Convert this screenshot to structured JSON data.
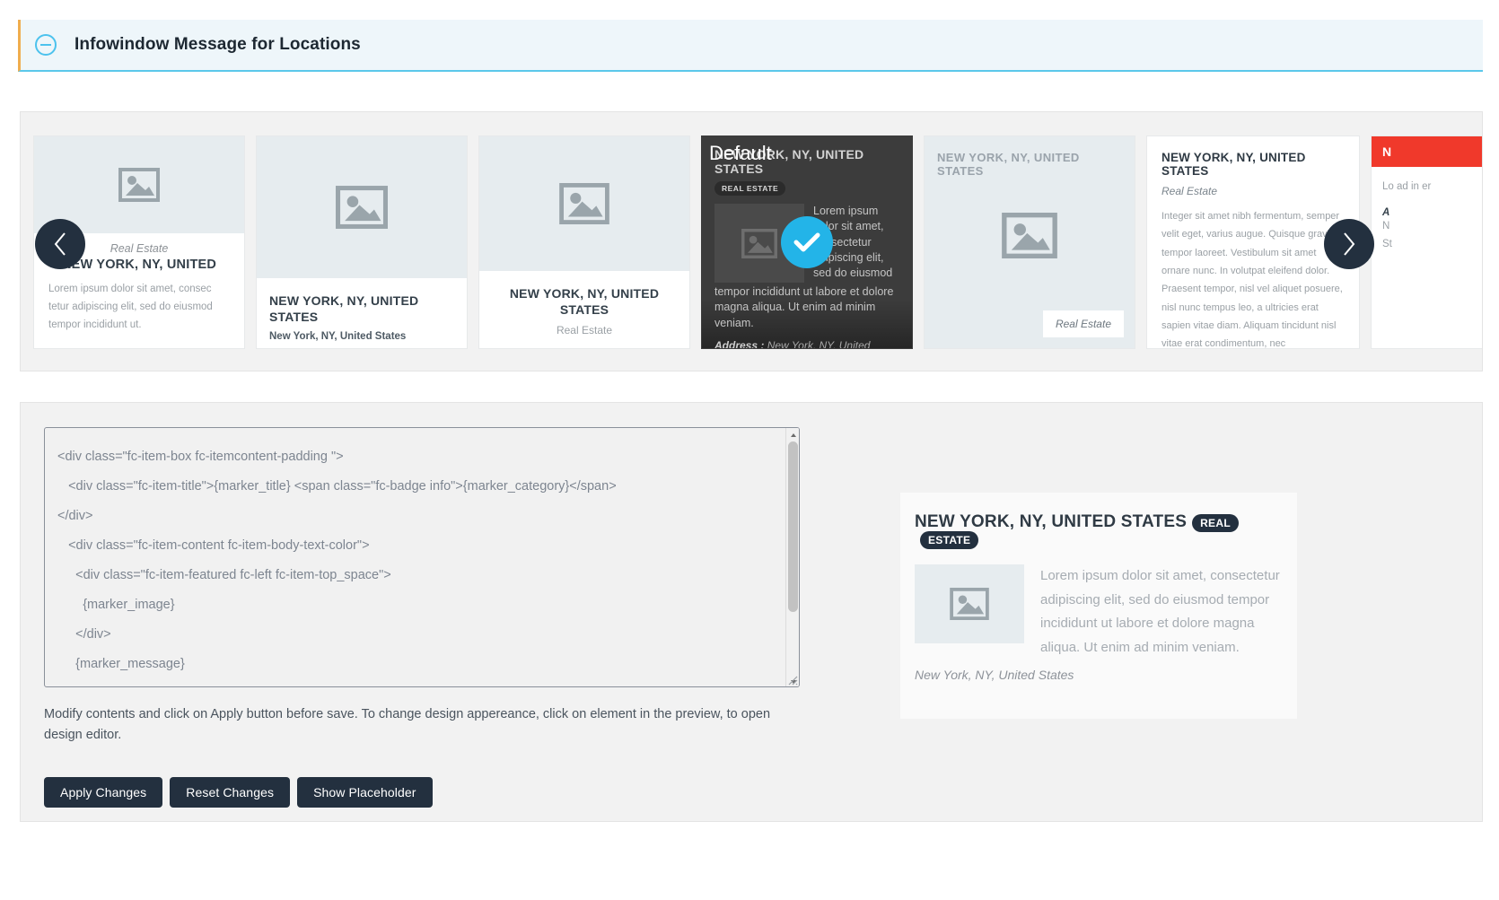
{
  "panel": {
    "title": "Infowindow Message for Locations",
    "collapse_icon": "minus-circle-icon"
  },
  "carousel": {
    "prev_label": "‹",
    "next_label": "›",
    "selected_label": "Default",
    "templates": [
      {
        "id": "template-1",
        "category": "Real Estate",
        "title": "NEW YORK, NY, UNITED",
        "body": "Lorem ipsum dolor sit amet, consec tetur adipiscing elit, sed do eiusmod tempor incididunt ut.",
        "image_icon": "image-placeholder-icon"
      },
      {
        "id": "template-2",
        "title": "NEW YORK, NY, UNITED STATES",
        "subtitle": "New York, NY, United States",
        "image_icon": "image-placeholder-icon"
      },
      {
        "id": "template-3",
        "title": "NEW YORK, NY, UNITED STATES",
        "category": "Real Estate",
        "image_icon": "image-placeholder-icon"
      },
      {
        "id": "template-4-default",
        "title": "NEW YORK, NY, UNITED STATES",
        "badge": "REAL ESTATE",
        "body_col": "Lorem ipsum dolor sit amet, consectetur adipiscing elit, sed do eiusmod",
        "body_flow": "tempor incididunt ut labore et dolore magna aliqua. Ut enim ad minim veniam.",
        "address_label": "Address :",
        "address_value": " New York, NY, United States",
        "image_icon": "image-placeholder-icon",
        "selected": true
      },
      {
        "id": "template-5",
        "title": "NEW YORK, NY, UNITED STATES",
        "category": "Real Estate",
        "image_icon": "image-placeholder-icon"
      },
      {
        "id": "template-6",
        "title": "NEW YORK, NY, UNITED STATES",
        "category": "Real Estate",
        "body": "Integer sit amet nibh fermentum, semper velit eget, varius augue. Quisque gravida tempor laoreet. Vestibulum sit amet ornare nunc. In volutpat eleifend dolor. Praesent tempor, nisl vel aliquet posuere, nisl nunc tempus leo, a ultricies erat sapien vitae diam. Aliquam tincidunt nisl vitae erat condimentum, nec condimentum."
      },
      {
        "id": "template-7",
        "title": "N",
        "body": "Lo ad in er",
        "address_label": "A",
        "address_line1": "N",
        "address_line2": "St"
      }
    ]
  },
  "editor": {
    "code": "<div class=\"fc-item-box fc-itemcontent-padding \">\n   <div class=\"fc-item-title\">{marker_title} <span class=\"fc-badge info\">{marker_category}</span>\n</div>\n   <div class=\"fc-item-content fc-item-body-text-color\">\n     <div class=\"fc-item-featured fc-left fc-item-top_space\">\n       {marker_image}\n     </div>\n     {marker_message}\n   </div>",
    "scroll_up_icon": "chevron-up-icon",
    "scroll_down_icon": "chevron-down-icon",
    "help_text": "Modify contents and click on Apply button before save. To change design appereance, click on element in the preview, to open design editor.",
    "buttons": [
      {
        "id": "apply-changes",
        "label": "Apply Changes"
      },
      {
        "id": "reset-changes",
        "label": "Reset Changes"
      },
      {
        "id": "show-placeholder",
        "label": "Show Placeholder"
      }
    ]
  },
  "preview": {
    "title": "NEW YORK, NY, UNITED STATES",
    "badge": "REAL ESTATE",
    "body": "Lorem ipsum dolor sit amet, consectetur adipiscing elit, sed do eiusmod tempor incididunt ut labore et dolore magna aliqua. Ut enim ad minim veniam.",
    "address": "New York, NY, United States",
    "image_icon": "image-placeholder-icon"
  },
  "colors": {
    "accent_blue": "#4cc2ed",
    "check_blue": "#23b4e8",
    "dark_navy": "#23303f",
    "header_bg": "#eef6fa",
    "orange_rule": "#f0ad4e",
    "red_header": "#f0392b"
  }
}
